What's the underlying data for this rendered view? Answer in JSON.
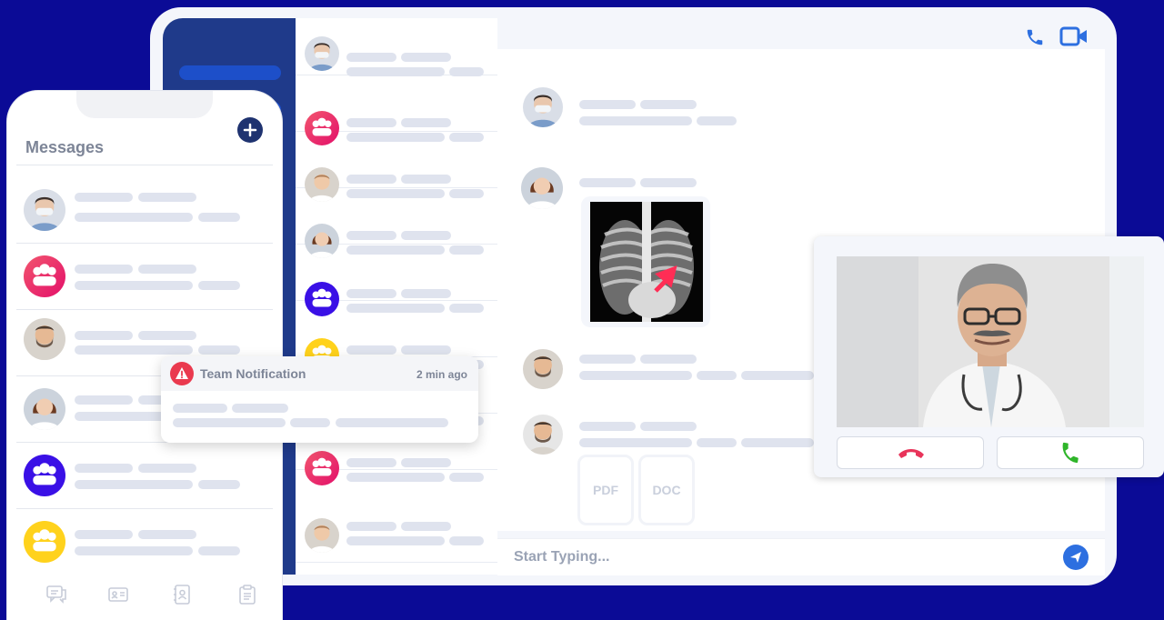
{
  "phone": {
    "title": "Messages",
    "contacts": [
      {
        "avatar": "doctor-mask-avatar"
      },
      {
        "avatar": "group-avatar",
        "color": "#ee2f6a"
      },
      {
        "avatar": "bearded-man-avatar"
      },
      {
        "avatar": "woman-avatar"
      },
      {
        "avatar": "group-avatar",
        "color": "#3a10e6"
      },
      {
        "avatar": "group-avatar",
        "color": "#ffd21c"
      }
    ],
    "bottom_nav": [
      "chat-icon",
      "id-card-icon",
      "contacts-icon",
      "clipboard-icon"
    ]
  },
  "notification": {
    "title": "Team Notification",
    "time": "2 min ago"
  },
  "chat": {
    "input_placeholder": "Start Typing...",
    "attachments": [
      "PDF",
      "DOC"
    ]
  },
  "colors": {
    "background": "#0b0b96",
    "sidebar": "#1f3a8a",
    "accent_blue": "#2d6fe0",
    "end_call": "#e8345a",
    "accept_call": "#2fb52a"
  }
}
